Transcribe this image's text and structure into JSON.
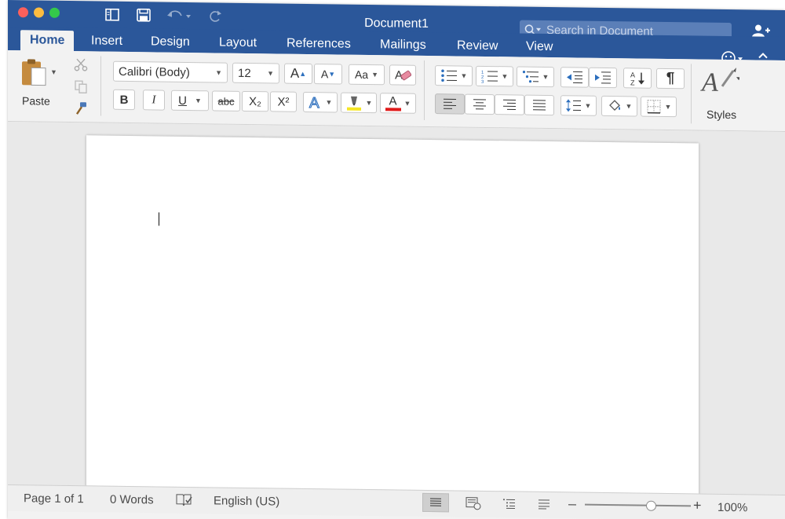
{
  "window": {
    "title": "Document1"
  },
  "search": {
    "placeholder": "Search in Document"
  },
  "tabs": [
    {
      "label": "Home",
      "active": true
    },
    {
      "label": "Insert"
    },
    {
      "label": "Design"
    },
    {
      "label": "Layout"
    },
    {
      "label": "References"
    },
    {
      "label": "Mailings"
    },
    {
      "label": "Review"
    },
    {
      "label": "View"
    }
  ],
  "ribbon": {
    "paste_label": "Paste",
    "font_name": "Calibri (Body)",
    "font_size": "12",
    "bold": "B",
    "italic": "I",
    "underline": "U",
    "strikethrough": "abc",
    "subscript": "X₂",
    "superscript": "X²",
    "font_color_letter": "A",
    "grow_font": "A",
    "shrink_font": "A",
    "change_case": "Aa",
    "pilcrow": "¶",
    "styles_label": "Styles",
    "highlight_color": "#f5e625",
    "font_color": "#e01b1b"
  },
  "status": {
    "page": "Page 1 of 1",
    "words": "0 Words",
    "language": "English (US)",
    "zoom": "100%",
    "zoom_level": 1.0
  },
  "colors": {
    "accent": "#2b579a",
    "tab_bg": "#2b579a"
  }
}
